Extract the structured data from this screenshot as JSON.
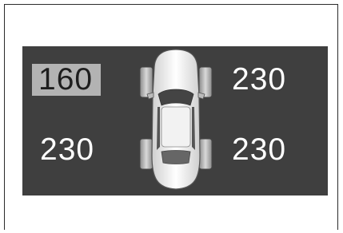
{
  "tire_pressure": {
    "front_left": "160",
    "front_right": "230",
    "rear_left": "230",
    "rear_right": "230",
    "low_highlight_color": "#b3b3b3",
    "panel_color": "#3f3f3f",
    "icon": "car-top-view-icon"
  }
}
